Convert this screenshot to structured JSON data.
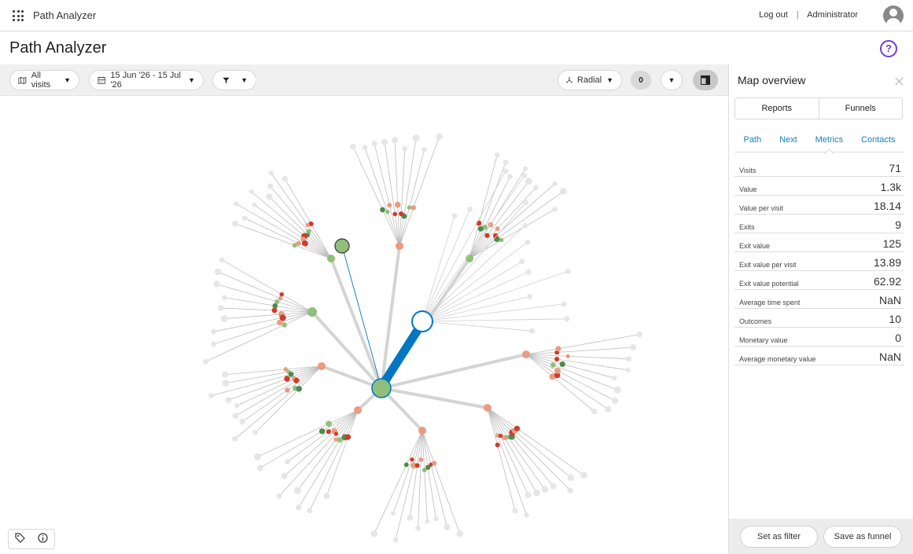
{
  "header": {
    "app_name": "Path Analyzer",
    "logout": "Log out",
    "separator": "|",
    "user": "Administrator"
  },
  "page": {
    "title": "Path Analyzer",
    "help": "?"
  },
  "toolbar": {
    "visits_filter": "All visits",
    "date_range": "15 Jun '26 - 15 Jul '26",
    "layout": "Radial",
    "filter_count": "0"
  },
  "side_panel": {
    "title": "Map overview",
    "segments": [
      "Reports",
      "Funnels"
    ],
    "tabs": [
      "Path",
      "Next",
      "Metrics",
      "Contacts"
    ],
    "active_tab": "Metrics",
    "metrics": [
      {
        "label": "Visits",
        "value": "71"
      },
      {
        "label": "Value",
        "value": "1.3k"
      },
      {
        "label": "Value per visit",
        "value": "18.14"
      },
      {
        "label": "Exits",
        "value": "9"
      },
      {
        "label": "Exit value",
        "value": "125"
      },
      {
        "label": "Exit value per visit",
        "value": "13.89"
      },
      {
        "label": "Exit value potential",
        "value": "62.92"
      },
      {
        "label": "Average time spent",
        "value": "NaN"
      },
      {
        "label": "Outcomes",
        "value": "10"
      },
      {
        "label": "Monetary value",
        "value": "0"
      },
      {
        "label": "Average monetary value",
        "value": "NaN"
      }
    ],
    "set_filter": "Set as filter",
    "save_funnel": "Save as funnel"
  },
  "colors": {
    "accent": "#1a7fb8",
    "help": "#6b3fd8",
    "node_green": "#8fbf7a",
    "node_dark_green": "#4e8a4a",
    "node_salmon": "#ec9a82",
    "node_red": "#cf3a2a",
    "node_gray": "#e6e6e6",
    "trunk_blue": "#0077c0"
  }
}
